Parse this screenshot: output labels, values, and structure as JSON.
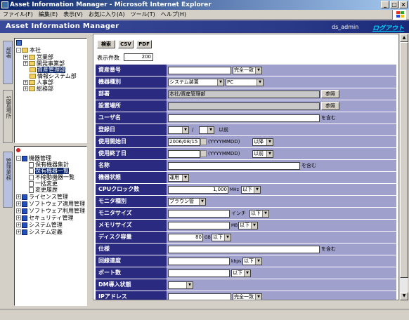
{
  "window": {
    "title": "Asset Information Manager - Microsoft Internet Explorer",
    "buttons": [
      "_",
      "□",
      "×"
    ]
  },
  "menu": [
    "ファイル(F)",
    "編集(E)",
    "表示(V)",
    "お気に入り(A)",
    "ツール(T)",
    "ヘルプ(H)"
  ],
  "app": {
    "title": "Asset Information Manager",
    "user": "ds_admin",
    "logout": "ログアウト"
  },
  "left": {
    "tab1": "部署",
    "tab2": "設置場所",
    "tab3": "管理業務",
    "org_tree": [
      {
        "label": "本社",
        "pm": "-"
      },
      {
        "label": "営業部",
        "pm": "+"
      },
      {
        "label": "開発事業部",
        "pm": "+"
      },
      {
        "label": "資産管理部",
        "pm": ""
      },
      {
        "label": "情報システム部",
        "pm": ""
      },
      {
        "label": "人事部",
        "pm": "+"
      },
      {
        "label": "総務部",
        "pm": "+"
      }
    ],
    "task_tree": [
      {
        "label": "機器管理",
        "pm": "-"
      },
      {
        "label": "保有機器集計",
        "pm": ""
      },
      {
        "label": "保有機器一覧",
        "pm": ""
      },
      {
        "label": "不稼動機器一覧",
        "pm": ""
      },
      {
        "label": "一括変更",
        "pm": ""
      },
      {
        "label": "変更履歴",
        "pm": ""
      },
      {
        "label": "ライセンス管理",
        "pm": "+"
      },
      {
        "label": "ソフトウェア適用管理",
        "pm": "+"
      },
      {
        "label": "ソフトウェア利用管理",
        "pm": "+"
      },
      {
        "label": "セキュリティ管理",
        "pm": "+"
      },
      {
        "label": "システム管理",
        "pm": "+"
      },
      {
        "label": "システム定義",
        "pm": "+"
      }
    ]
  },
  "toolbar": {
    "search": "検索",
    "csv": "CSV",
    "pdf": "PDF"
  },
  "count": {
    "label": "表示件数",
    "value": "200"
  },
  "form": {
    "asset_no": {
      "label": "資産番号",
      "match": "完全一致"
    },
    "device_type": {
      "label": "機器種別",
      "category": "システム装置",
      "type": "PC"
    },
    "dept": {
      "label": "部署",
      "value": "本社/資産管理部",
      "ref": "参照"
    },
    "location": {
      "label": "設置場所",
      "ref": "参照"
    },
    "user": {
      "label": "ユーザ名",
      "suffix": "を含む"
    },
    "reg_date": {
      "label": "登録日",
      "sep": "/",
      "after": "以前"
    },
    "start_date": {
      "label": "使用開始日",
      "value": "2006/08/15",
      "format": "(YYYYMMDD)",
      "cond": "以降"
    },
    "end_date": {
      "label": "使用終了日",
      "format": "(YYYYMMDD)",
      "cond": "以前"
    },
    "name": {
      "label": "名称",
      "suffix": "を含む"
    },
    "status": {
      "label": "機器状態",
      "value": "運用"
    },
    "cpu": {
      "label": "CPUクロック数",
      "value": "1,000",
      "unit": "MHz",
      "cond": "以下"
    },
    "monitor_type": {
      "label": "モニタ種別",
      "value": "ブラウン管"
    },
    "monitor_size": {
      "label": "モニタサイズ",
      "unit": "インチ",
      "cond": "以下"
    },
    "memory": {
      "label": "メモリサイズ",
      "unit": "MB",
      "cond": "以下"
    },
    "disk": {
      "label": "ディスク容量",
      "value": "80",
      "unit": "GB",
      "cond": "以下"
    },
    "spec": {
      "label": "仕様",
      "suffix": "を含む"
    },
    "line_speed": {
      "label": "回線速度",
      "unit": "kbps",
      "cond": "以下"
    },
    "ports": {
      "label": "ポート数",
      "cond": "以下"
    },
    "dm": {
      "label": "DM導入状態"
    },
    "ip": {
      "label": "IPアドレス",
      "match": "完全一致"
    }
  }
}
